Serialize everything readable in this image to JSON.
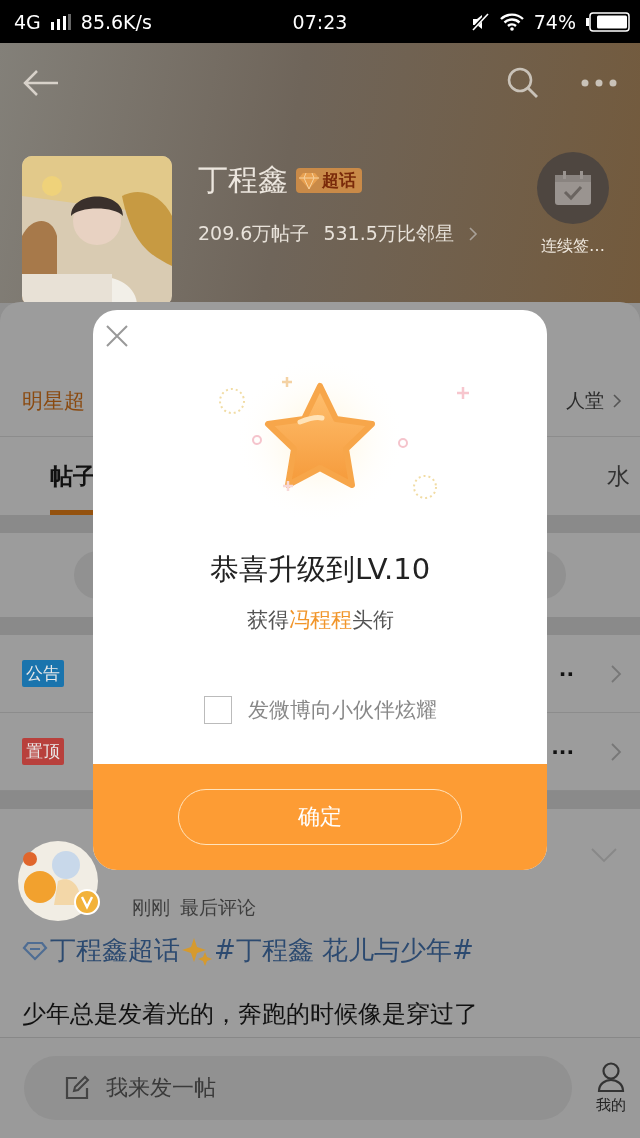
{
  "status_bar": {
    "network": "4G",
    "speed": "85.6K/s",
    "time": "07:23",
    "battery": "74%"
  },
  "topic": {
    "name": "丁程鑫",
    "badge": "超话",
    "posts": "209.6万帖子",
    "fans": "531.5万比邻星",
    "checkin": "连续签…"
  },
  "links": {
    "left": "明星超",
    "right": "人堂"
  },
  "tabs": [
    {
      "label": "帖子",
      "selected": true
    },
    {
      "label": "水",
      "selected": false
    }
  ],
  "notices": [
    {
      "tag": "公告",
      "color": "#1a74ad",
      "more": "··"
    },
    {
      "tag": "置顶",
      "color": "#b8403c",
      "more": "···"
    }
  ],
  "post": {
    "time": "刚刚",
    "meta": "最后评论",
    "topic": "丁程鑫超话",
    "tag": "#丁程鑫 花儿与少年#",
    "body": "少年总是发着光的，奔跑的时候像是穿过了"
  },
  "bottom_bar": {
    "placeholder": "我来发一帖",
    "profile": "我的"
  },
  "dialog": {
    "title": "恭喜升级到LV.10",
    "subtitle_prefix": "获得",
    "subtitle_highlight": "冯程程",
    "subtitle_suffix": "头衔",
    "share_label": "发微博向小伙伴炫耀",
    "share_checked": false,
    "confirm": "确定"
  }
}
